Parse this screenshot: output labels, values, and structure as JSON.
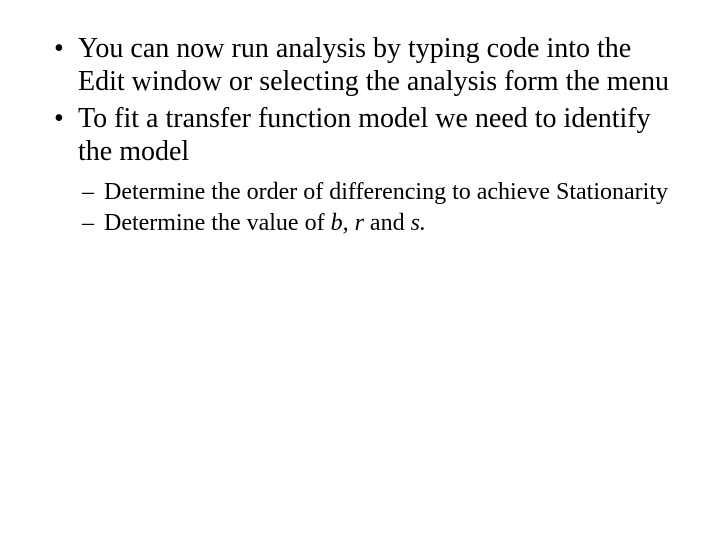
{
  "bullets": [
    {
      "text": "You can now run analysis by typing code into the Edit window or selecting the analysis form the menu"
    },
    {
      "text": "To fit a transfer function model we need to identify the model",
      "sub": [
        {
          "text": "Determine the order of differencing to achieve Stationarity"
        },
        {
          "pre": "Determine the value of ",
          "v1": "b, r",
          "mid": " and ",
          "v2": "s."
        }
      ]
    }
  ]
}
